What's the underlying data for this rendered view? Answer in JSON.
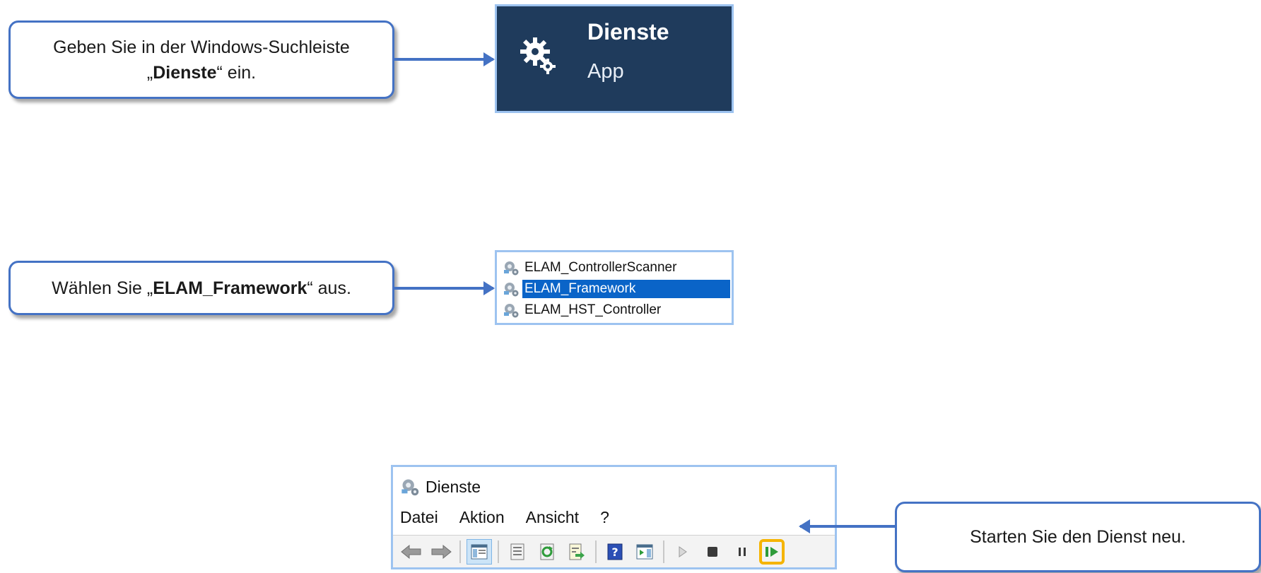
{
  "callouts": {
    "step1": {
      "text_before": "Geben Sie in der Windows-Suchleiste „",
      "bold": "Dienste",
      "text_after": "“ ein."
    },
    "step2": {
      "text_before": "Wählen Sie „",
      "bold": "ELAM_Framework",
      "text_after": "“ aus."
    },
    "step3": {
      "text": "Starten Sie den Dienst neu."
    }
  },
  "search_result": {
    "title": "Dienste",
    "subtitle": "App",
    "icon": "gear-icon"
  },
  "service_list": {
    "items": [
      {
        "label": "ELAM_ControllerScanner",
        "selected": false
      },
      {
        "label": "ELAM_Framework",
        "selected": true
      },
      {
        "label": "ELAM_HST_Controller",
        "selected": false
      }
    ],
    "selected_color": "#0a64c8"
  },
  "mmc_window": {
    "title": "Dienste",
    "menu": [
      "Datei",
      "Aktion",
      "Ansicht",
      "?"
    ],
    "toolbar": [
      "back-icon",
      "forward-icon",
      "show-hide-console-tree-icon",
      "properties-icon",
      "refresh-icon",
      "export-list-icon",
      "help-icon",
      "show-hide-action-pane-icon",
      "start-service-icon",
      "stop-service-icon",
      "pause-service-icon",
      "restart-service-icon"
    ],
    "highlighted_button": "restart-service-icon",
    "highlight_color": "#f5b400"
  },
  "colors": {
    "accent": "#4472c4",
    "search_bg": "#1f3b5c",
    "frame": "#9dc3f0"
  }
}
